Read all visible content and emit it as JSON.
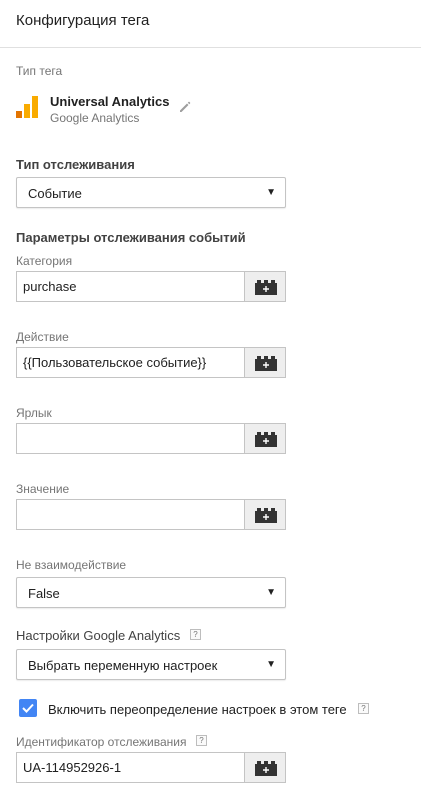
{
  "header": {
    "title": "Конфигурация тега"
  },
  "tag_type": {
    "label": "Тип тега",
    "name": "Universal Analytics",
    "provider": "Google Analytics",
    "icons": {
      "logo": "google-analytics-icon",
      "edit": "pencil-icon"
    },
    "logo_color": "#f9ab00"
  },
  "tracking_type": {
    "label": "Тип отслеживания",
    "value": "Событие"
  },
  "event_params": {
    "title": "Параметры отслеживания событий",
    "category": {
      "label": "Категория",
      "value": "purchase"
    },
    "action": {
      "label": "Действие",
      "value": "{{Пользовательское событие}}"
    },
    "label": {
      "label": "Ярлык",
      "value": ""
    },
    "value": {
      "label": "Значение",
      "value": ""
    }
  },
  "non_interaction": {
    "label": "Не взаимодействие",
    "value": "False"
  },
  "ga_settings": {
    "title": "Настройки Google Analytics",
    "value": "Выбрать переменную настроек",
    "help": "?"
  },
  "override": {
    "label": "Включить переопределение настроек в этом теге",
    "checked": true,
    "help": "?",
    "checkbox_color": "#4285f4"
  },
  "tracking_id": {
    "label": "Идентификатор отслеживания",
    "value": "UA-114952926-1",
    "help": "?"
  },
  "colors": {
    "accent": "#4285f4",
    "muted_text": "#757575",
    "border": "#c4c4c4",
    "button_bg": "#eeeeee"
  }
}
